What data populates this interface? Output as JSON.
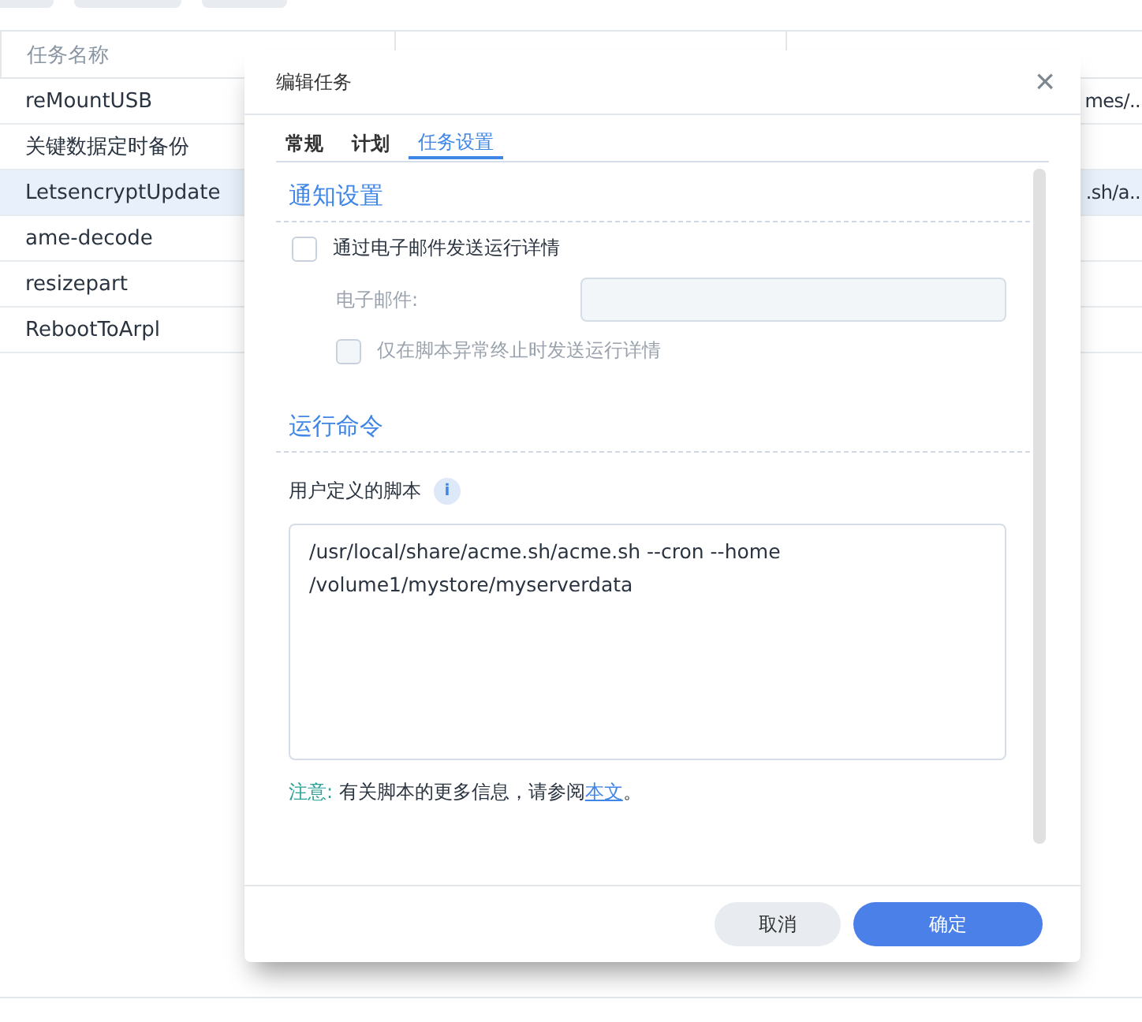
{
  "table": {
    "columns": [
      "任务名称"
    ],
    "rows": [
      {
        "name": "reMountUSB",
        "column_3": "mes/..",
        "selected": false
      },
      {
        "name": "关键数据定时备份",
        "column_3": "",
        "selected": false
      },
      {
        "name": "LetsencryptUpdate",
        "column_3": ".sh/a..",
        "selected": true
      },
      {
        "name": "ame-decode",
        "column_3": "",
        "selected": false
      },
      {
        "name": "resizepart",
        "column_3": "",
        "selected": false
      },
      {
        "name": "RebootToArpl",
        "column_3": "",
        "selected": false
      }
    ]
  },
  "dialog": {
    "title": "编辑任务",
    "close": "×",
    "tabs": [
      {
        "label": "常规",
        "selected": false
      },
      {
        "label": "计划",
        "selected": false
      },
      {
        "label": "任务设置",
        "selected": true
      }
    ],
    "notify_section": "通知设置",
    "email_checkbox": {
      "label": "通过电子邮件发送运行详情",
      "checked": false
    },
    "email_field": {
      "label": "电子邮件:",
      "disabled": true
    },
    "abnormal_checkbox": {
      "label": "仅在脚本异常终止时发送运行详情",
      "checked": false,
      "disabled": true
    },
    "command_section": "运行命令",
    "script_label": "用户定义的脚本",
    "info": "i",
    "script": "/usr/local/share/acme.sh/acme.sh --cron --home /volume1/mystore/myserverdata",
    "note_label": "注意:",
    "note": "有关脚本的更多信息，请参阅",
    "note_link": "本文",
    "note_end": "。",
    "buttons": [
      {
        "label": "取消",
        "kind": "secondary"
      },
      {
        "label": "确定",
        "kind": "primary"
      }
    ]
  }
}
